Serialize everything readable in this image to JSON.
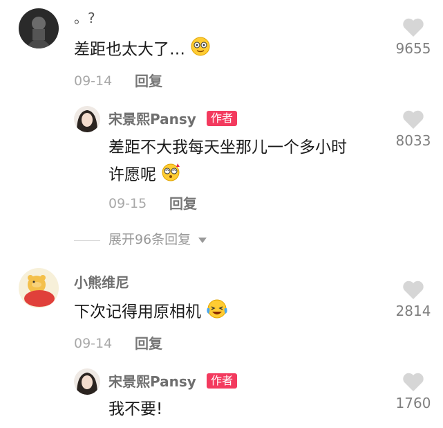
{
  "comments": [
    {
      "user": "。?",
      "text": "差距也太大了…",
      "date": "09-14",
      "reply_label": "回复",
      "likes": "9655",
      "emoji_icon": "smiling-face-icon"
    },
    {
      "user": "宋景熙Pansy",
      "badge": "作者",
      "text_line1": "差距不大我每天坐那儿一个多小时",
      "text_line2": "许愿呢",
      "date": "09-15",
      "reply_label": "回复",
      "likes": "8033",
      "emoji_icon": "dizzy-face-icon"
    },
    {
      "expand_label": "展开96条回复"
    },
    {
      "user": "小熊维尼",
      "text": "下次记得用原相机",
      "date": "09-14",
      "reply_label": "回复",
      "likes": "2814",
      "emoji_icon": "laughing-tears-icon"
    },
    {
      "user": "宋景熙Pansy",
      "badge": "作者",
      "text": "我不要!",
      "likes": "1760"
    }
  ],
  "colors": {
    "badge": "#f33a5e",
    "heart": "#d6d6d6",
    "name": "#6f6f6f",
    "meta": "#a8a8a8"
  }
}
